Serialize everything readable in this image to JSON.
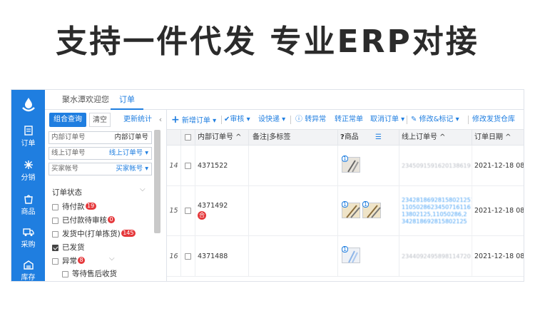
{
  "headline": "支持一件代发 专业ERP对接",
  "colors": {
    "primary": "#1f7ee0",
    "danger": "#e5383b",
    "success": "#2aa84a"
  },
  "sidebar": {
    "logo_icon": "water-drop-logo-icon",
    "items": [
      {
        "label": "订单",
        "icon": "order-icon"
      },
      {
        "label": "分销",
        "icon": "distribution-icon"
      },
      {
        "label": "商品",
        "icon": "goods-icon"
      },
      {
        "label": "采购",
        "icon": "purchase-truck-icon"
      },
      {
        "label": "库存",
        "icon": "warehouse-icon"
      }
    ]
  },
  "tabs": [
    {
      "label": "聚水潭欢迎您"
    },
    {
      "label": "订单"
    }
  ],
  "filter": {
    "query_button": "组合查询",
    "clear_button": "清空",
    "refresh_link": "更新统计",
    "collapse": "‹",
    "fields": [
      {
        "placeholder": "内部订单号",
        "selected": "内部订单号"
      },
      {
        "placeholder": "线上订单号",
        "selected": "线上订单号"
      },
      {
        "placeholder": "买家帐号",
        "selected": "买家帐号"
      }
    ],
    "status_title": "订单状态",
    "statuses": [
      {
        "label": "待付款",
        "count": "19",
        "checked": false
      },
      {
        "label": "已付款待审核",
        "count": "0",
        "checked": false
      },
      {
        "label": "发货中(打单拣货)",
        "count": "145",
        "checked": false
      },
      {
        "label": "已发货",
        "count": "",
        "checked": true
      },
      {
        "label": "异常",
        "count": "8",
        "checked": false
      },
      {
        "label": "等待售后收货",
        "count": "",
        "checked": false
      }
    ]
  },
  "toolbar": {
    "add_order": "新增订单",
    "review": "审核",
    "set_express": "设快递",
    "to_abnormal": "转异常",
    "to_normal": "转正常单",
    "cancel_order": "取消订单",
    "modify_mark": "修改&标记",
    "modify_warehouse": "修改发货仓库"
  },
  "table": {
    "headers": [
      "内部订单号",
      "备注|多标签",
      "商品",
      "线上订单号",
      "订单日期"
    ],
    "rows": [
      {
        "num": "14",
        "order_no": "4371522",
        "merge_tag": "",
        "goods_count": [
          "1"
        ],
        "online_no": [
          "2345091591620138619"
        ],
        "online_blue": false,
        "date": "2021-12-18 08"
      },
      {
        "num": "15",
        "order_no": "4371492",
        "merge_tag": "合",
        "goods_count": [
          "1",
          "1"
        ],
        "online_no": [
          "23428186928158021251",
          "1105028623450716116",
          "13802125,11050286,2",
          "342818692815802125"
        ],
        "online_blue": true,
        "date": "2021-12-18 08"
      },
      {
        "num": "16",
        "order_no": "4371488",
        "merge_tag": "",
        "goods_count": [
          "1"
        ],
        "online_no": [
          "2344092495898114720"
        ],
        "online_blue": false,
        "date": "2021-12-18 08"
      }
    ]
  }
}
